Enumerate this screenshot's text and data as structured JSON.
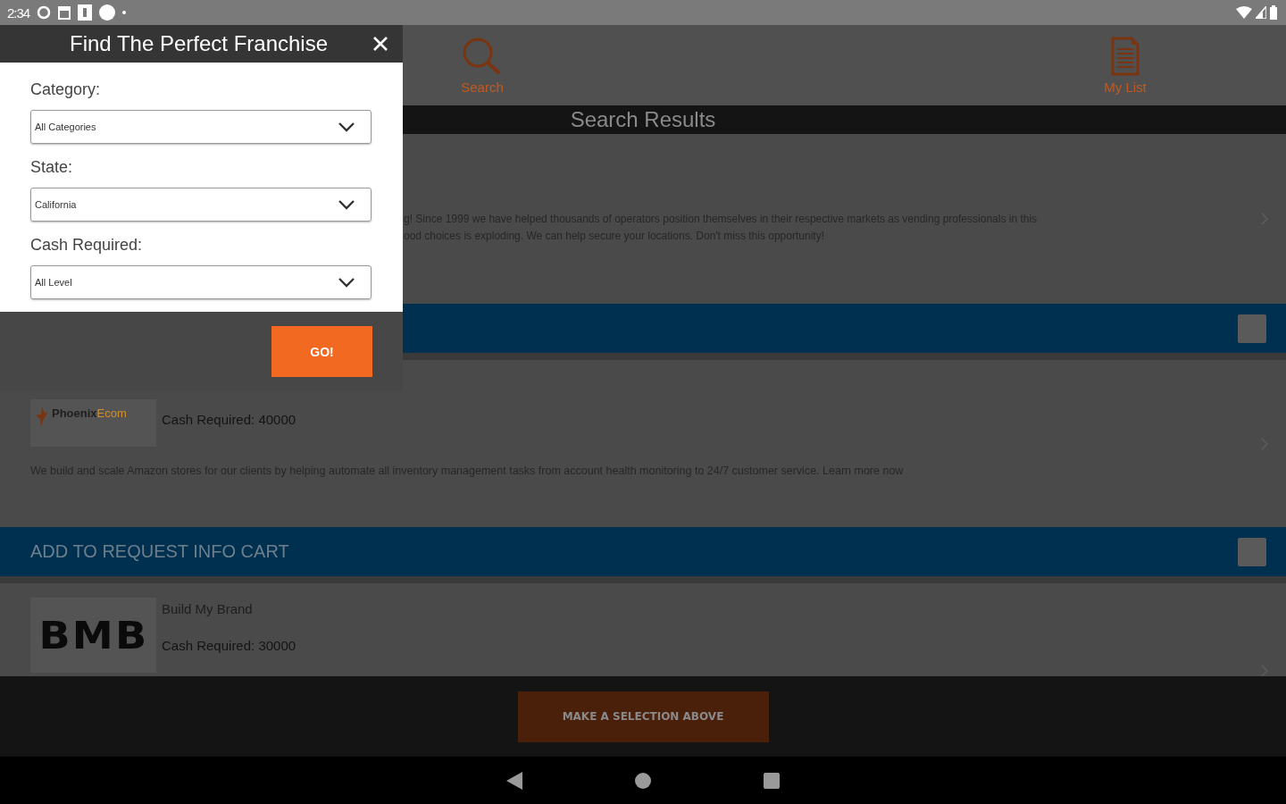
{
  "status_bar": {
    "time": "2:34"
  },
  "tabs": [
    {
      "kind": "search",
      "label": "Search"
    },
    {
      "kind": "list",
      "label": "My List"
    }
  ],
  "results_header": "Search Results",
  "results": [
    {
      "description_lines": [
        "g! Since 1999 we have helped thousands of operators position themselves in their respective markets as vending professionals in this",
        "ood choices is exploding. We can help secure your locations. Don't miss this opportunity!"
      ],
      "cart": {
        "checked": false
      }
    },
    {
      "logo": {
        "kind": "phoenix",
        "parts": [
          "Phoenix",
          "Ecom"
        ]
      },
      "cash": "Cash Required: 40000",
      "description_lines": [
        "We build and scale Amazon stores for our clients by helping automate all inventory management tasks from account health monitoring to 24/7 customer service. Learn more now"
      ],
      "cart": {
        "label": "ADD TO REQUEST INFO CART",
        "checked": false
      }
    },
    {
      "logo": {
        "kind": "bmb",
        "text": "BMB"
      },
      "name": "Build My Brand",
      "cash": "Cash Required: 30000"
    }
  ],
  "footer_button": "MAKE A SELECTION ABOVE",
  "modal": {
    "title": "Find The Perfect Franchise",
    "fields": [
      {
        "label": "Category:",
        "value": "All Categories"
      },
      {
        "label": "State:",
        "value": "California"
      },
      {
        "label": "Cash Required:",
        "value": "All Level"
      }
    ],
    "submit": "GO!"
  }
}
